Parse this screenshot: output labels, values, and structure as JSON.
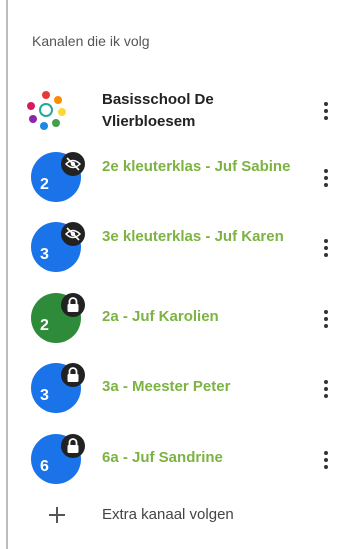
{
  "section_title": "Kanalen die ik volg",
  "colors": {
    "blue": "#1a73e8",
    "green": "#2e8b3a",
    "label_green": "#7cb342"
  },
  "channels": [
    {
      "label": "Basisschool De Vlierbloesem",
      "type": "logo"
    },
    {
      "label": "2e kleuterklas - Juf Sabine",
      "number": "2",
      "badge": "eye-off-icon",
      "color": "#1a73e8"
    },
    {
      "label": "3e kleuterklas - Juf Karen",
      "number": "3",
      "badge": "eye-off-icon",
      "color": "#1a73e8"
    },
    {
      "label": "2a - Juf Karolien",
      "number": "2",
      "badge": "lock-icon",
      "color": "#2e8b3a"
    },
    {
      "label": "3a - Meester Peter",
      "number": "3",
      "badge": "lock-icon",
      "color": "#1a73e8"
    },
    {
      "label": "6a - Juf Sandrine",
      "number": "6",
      "badge": "lock-icon",
      "color": "#1a73e8"
    }
  ],
  "add_channel": {
    "label": "Extra kanaal volgen",
    "icon": "plus-icon"
  }
}
